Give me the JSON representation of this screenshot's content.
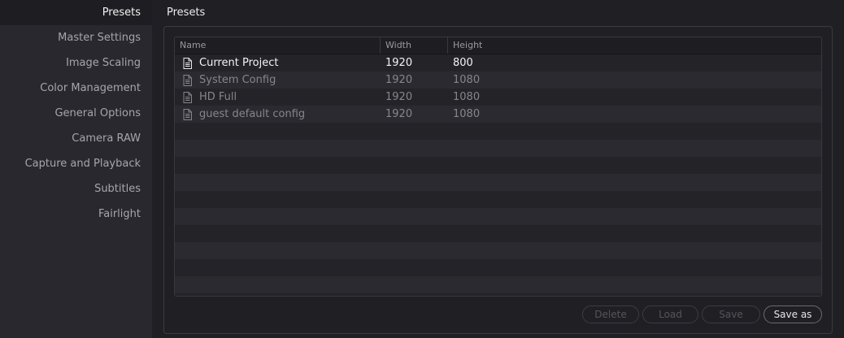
{
  "sidebar": {
    "items": [
      {
        "label": "Presets",
        "active": true
      },
      {
        "label": "Master Settings"
      },
      {
        "label": "Image Scaling"
      },
      {
        "label": "Color Management"
      },
      {
        "label": "General Options"
      },
      {
        "label": "Camera RAW"
      },
      {
        "label": "Capture and Playback"
      },
      {
        "label": "Subtitles"
      },
      {
        "label": "Fairlight"
      }
    ]
  },
  "main": {
    "title": "Presets",
    "table": {
      "columns": [
        "Name",
        "Width",
        "Height"
      ],
      "rows": [
        {
          "name": "Current Project",
          "width": "1920",
          "height": "800",
          "active": true
        },
        {
          "name": "System Config",
          "width": "1920",
          "height": "1080"
        },
        {
          "name": "HD Full",
          "width": "1920",
          "height": "1080"
        },
        {
          "name": "guest default config",
          "width": "1920",
          "height": "1080"
        }
      ],
      "row_icon": "document-icon"
    },
    "buttons": {
      "delete": "Delete",
      "load": "Load",
      "save": "Save",
      "save_as": "Save as"
    }
  }
}
